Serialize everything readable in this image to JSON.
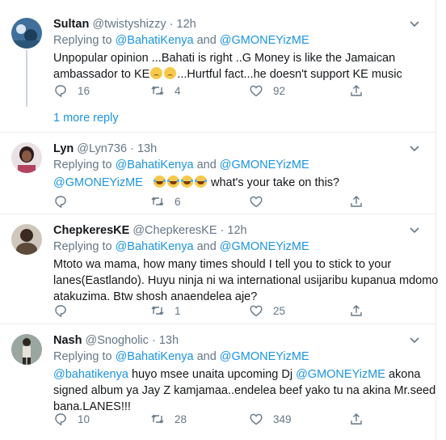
{
  "tweets": [
    {
      "name": "Sultan",
      "handle": "@twistyshizzy",
      "time": "12h",
      "replying": "Replying to",
      "mention1": "@BahatiKenya",
      "and": "and",
      "mention2": "@GMONEYizME",
      "line1": "Unpopular opinion ...Bahati is right ..G Money is like the Jamaican",
      "line2a": "ambassador to KE",
      "line2b": "...Hurtful fact...he doesn't support  KE music",
      "replies": "16",
      "retweets": "4",
      "likes": "92"
    },
    {
      "name": "Lyn",
      "handle": "@Lyn736",
      "time": "13h",
      "replying": "Replying to",
      "mention1": "@BahatiKenya",
      "and": "and",
      "mention2": "@GMONEYizME",
      "body_mention": "@GMONEYizME",
      "body_text": "what's your take on this?",
      "replies": "",
      "retweets": "6",
      "likes": ""
    },
    {
      "name": "ChepkeresKE",
      "handle": "@ChepkeresKE",
      "time": "12h",
      "replying": "Replying to",
      "mention1": "@BahatiKenya",
      "and": "and",
      "mention2": "@GMONEYizME",
      "line1": "Mtoto wa mama, how many times should I tell you to stick to your",
      "line2": "lanes(Eastlando). Huyu ninja ni wa international usijaribu kupanua mdomo",
      "line3": "atakuzima. Btw shosh anaendelea aje?",
      "replies": "",
      "retweets": "1",
      "likes": "25"
    },
    {
      "name": "Nash",
      "handle": "@Snogholic",
      "time": "13h",
      "replying": "Replying to",
      "mention1": "@BahatiKenya",
      "and": "and",
      "mention2": "@GMONEYizME",
      "l1_mention": "@bahatikenya",
      "l1_mid": "huyo msee unaita upcoming Dj",
      "l1_mention2": "@GMONEYizME",
      "l1_end": "akona",
      "line2": "signed album ya Jay Z kamjamaa..endelea beef yako tu na akina Mr.seed",
      "line3": "bana.LANES!!!",
      "replies": "10",
      "retweets": "28",
      "likes": "349"
    }
  ],
  "show_more": "1 more reply",
  "colors": {
    "link": "#1b95e0",
    "muted": "#657786",
    "border": "#e6ecf0"
  },
  "icons": [
    "reply-icon",
    "retweet-icon",
    "like-icon",
    "share-icon",
    "caret-down-icon"
  ]
}
